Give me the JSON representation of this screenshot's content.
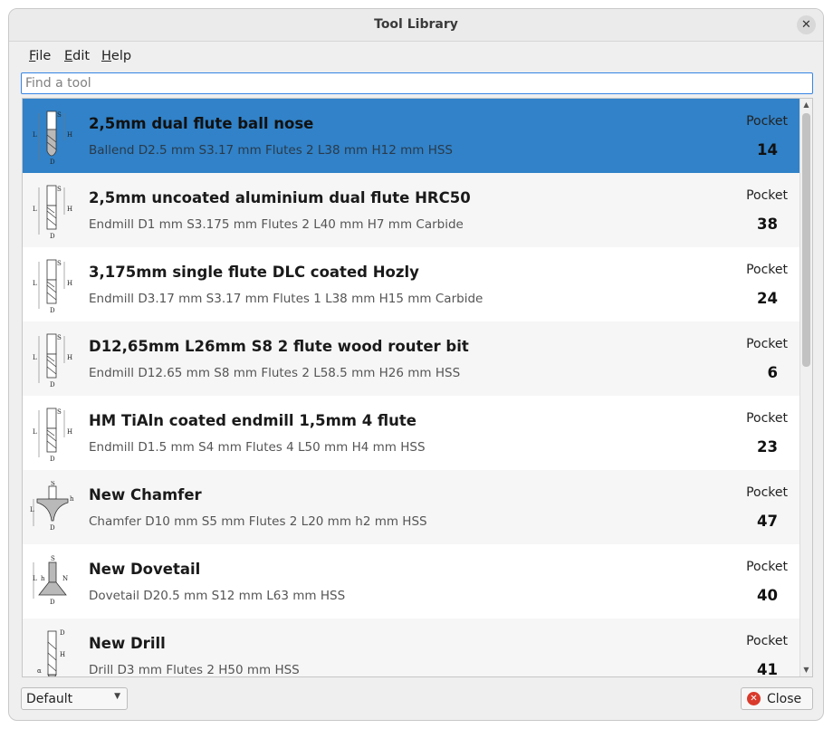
{
  "window": {
    "title": "Tool Library"
  },
  "menubar": [
    {
      "label": "File",
      "u": "F",
      "rest": "ile"
    },
    {
      "label": "Edit",
      "u": "E",
      "rest": "dit"
    },
    {
      "label": "Help",
      "u": "H",
      "rest": "elp"
    }
  ],
  "search": {
    "placeholder": "Find a tool",
    "value": ""
  },
  "pocket_label": "Pocket",
  "tools": [
    {
      "name": "2,5mm dual flute ball nose",
      "desc": "Ballend D2.5 mm S3.17 mm Flutes 2 L38 mm H12 mm HSS",
      "pocket": "14",
      "icon": "ballend-icon",
      "selected": true
    },
    {
      "name": "2,5mm uncoated aluminium dual flute HRC50",
      "desc": "Endmill D1 mm S3.175 mm Flutes 2 L40 mm H7 mm Carbide",
      "pocket": "38",
      "icon": "endmill-icon"
    },
    {
      "name": "3,175mm single flute DLC coated Hozly",
      "desc": "Endmill D3.17 mm S3.17 mm Flutes 1 L38 mm H15 mm Carbide",
      "pocket": "24",
      "icon": "endmill-icon"
    },
    {
      "name": "D12,65mm L26mm S8 2 flute wood router bit",
      "desc": "Endmill D12.65 mm S8 mm Flutes 2 L58.5 mm H26 mm HSS",
      "pocket": "6",
      "icon": "endmill-icon"
    },
    {
      "name": "HM TiAln coated endmill 1,5mm 4 flute",
      "desc": "Endmill D1.5 mm S4 mm Flutes 4 L50 mm H4 mm HSS",
      "pocket": "23",
      "icon": "endmill-icon"
    },
    {
      "name": "New Chamfer",
      "desc": "Chamfer D10 mm S5 mm Flutes 2 L20 mm h2 mm HSS",
      "pocket": "47",
      "icon": "chamfer-icon"
    },
    {
      "name": "New Dovetail",
      "desc": "Dovetail D20.5 mm S12 mm L63 mm HSS",
      "pocket": "40",
      "icon": "dovetail-icon"
    },
    {
      "name": "New Drill",
      "desc": "Drill D3 mm Flutes 2 H50 mm HSS",
      "pocket": "41",
      "icon": "drill-icon"
    }
  ],
  "footer": {
    "library": "Default",
    "close_label": "Close"
  },
  "colors": {
    "selected": "#3182c8",
    "accent": "#3584e4",
    "close_icon": "#d93a2b"
  }
}
